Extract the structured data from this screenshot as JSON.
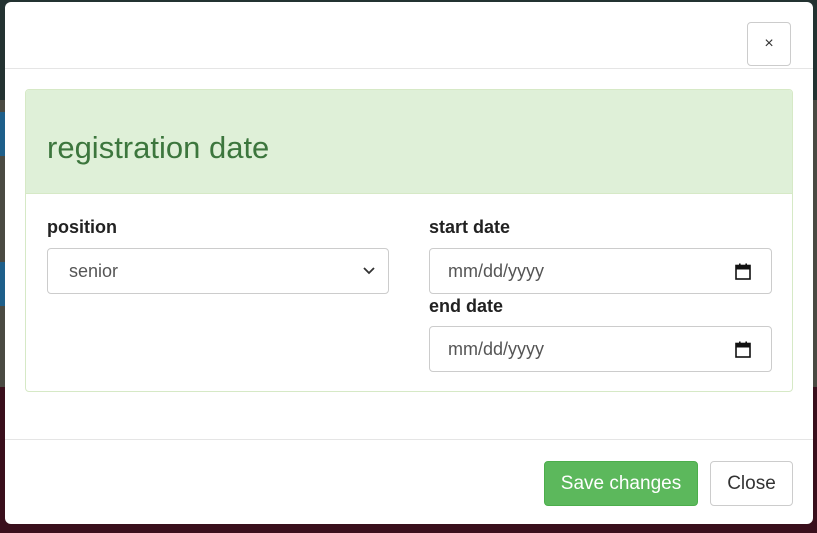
{
  "modal": {
    "close_icon_glyph": "×",
    "panel": {
      "title": "registration date"
    },
    "position": {
      "label": "position",
      "selected": "senior"
    },
    "start_date": {
      "label": "start date",
      "placeholder": "mm/dd/yyyy"
    },
    "end_date": {
      "label": "end date",
      "placeholder": "mm/dd/yyyy"
    },
    "footer": {
      "save_label": "Save changes",
      "close_label": "Close"
    }
  },
  "colors": {
    "panel_heading_bg": "#dff0d8",
    "panel_title": "#3c763d",
    "save_button": "#5cb85c"
  },
  "icons": [
    "close-icon",
    "chevron-down-icon",
    "calendar-icon"
  ]
}
